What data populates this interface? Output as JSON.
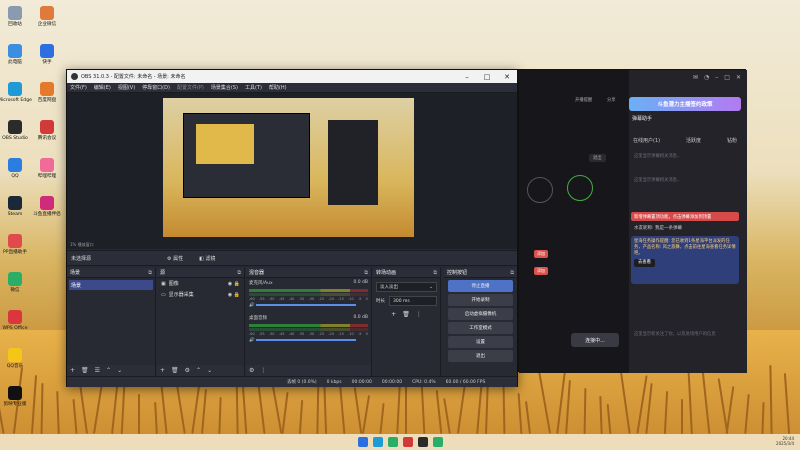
{
  "desktop": {
    "icons": [
      {
        "label": "回收站",
        "color": "#8a9bb0"
      },
      {
        "label": "此电脑",
        "color": "#3c8ee0"
      },
      {
        "label": "Microsoft Edge",
        "color": "#1f9ad6"
      },
      {
        "label": "OBS Studio",
        "color": "#2b2b2b"
      },
      {
        "label": "QQ",
        "color": "#2b7ee0"
      },
      {
        "label": "Steam",
        "color": "#1b2838"
      },
      {
        "label": "PP直播助手",
        "color": "#e04a4a"
      },
      {
        "label": "微信",
        "color": "#2aae67"
      },
      {
        "label": "WPS Office",
        "color": "#d9363e"
      },
      {
        "label": "QQ音乐",
        "color": "#f5c518"
      },
      {
        "label": "剪映专业版",
        "color": "#111111"
      }
    ],
    "icons_right": [
      {
        "label": "企业微信",
        "color": "#e07a3a"
      },
      {
        "label": "快手",
        "color": "#2d6fe0"
      },
      {
        "label": "百度网盘",
        "color": "#e57a2c"
      },
      {
        "label": "腾讯会议",
        "color": "#d23a3a"
      },
      {
        "label": "哔哩哔哩",
        "color": "#f16b9a"
      },
      {
        "label": "斗鱼直播伴侣",
        "color": "#d02a7a"
      }
    ]
  },
  "obs": {
    "title": "OBS 31.0.3 - 配置文件: 未命名 - 场景: 未命名",
    "menu": [
      "文件(F)",
      "编辑(E)",
      "视图(V)",
      "停靠窗口(D)",
      "配置文件(P)",
      "场景集合(S)",
      "工具(T)",
      "帮助(H)"
    ],
    "menu_disabled_index": 4,
    "status_top": "1% 播放窗口",
    "source_label": "未选择源",
    "btn_properties": "属性",
    "btn_filters": "滤镜",
    "scenes": {
      "title": "场景",
      "items": [
        "场景"
      ]
    },
    "sources": {
      "title": "源",
      "items": [
        "图像",
        "显示器采集"
      ]
    },
    "mixer": {
      "title": "混音器",
      "channels": [
        {
          "name": "麦克风/Aux",
          "db": "0.0 dB"
        },
        {
          "name": "桌面音频",
          "db": "0.0 dB"
        }
      ],
      "scale": [
        "-60",
        "-55",
        "-50",
        "-45",
        "-40",
        "-35",
        "-30",
        "-25",
        "-20",
        "-15",
        "-10",
        "-5",
        "0"
      ]
    },
    "transitions": {
      "title": "转场动画",
      "selected": "淡入淡出",
      "duration_label": "时长",
      "duration": "300 ms"
    },
    "controls": {
      "title": "控制按钮",
      "buttons": [
        "停止直播",
        "开始录制",
        "启动虚拟摄像机",
        "工作室模式",
        "设置",
        "退出"
      ]
    },
    "statusbar": {
      "frames": "丢帧 0 (0.0%)",
      "bitrate": "0 kbps",
      "live_time": "00:00:00",
      "rec_time": "00:00:00",
      "cpu": "CPU: 0.4%",
      "fps": "60.00 / 60.00 FPS"
    }
  },
  "app": {
    "banner": "斗鱼潜力主播签约政策",
    "tabs": [
      "在线用户(1)",
      "活跃度",
      "钻粉"
    ],
    "panel_title": "弹幕助手",
    "hint1": "这里显示弹幕相关消息，",
    "hint2": "这里显示弹幕相关消息，",
    "notice": "新增弹幕置顶功能，点击弹幕添加到顶置",
    "user_line": "水友昵称: 我是一条弹幕",
    "card_text": "星海任务操作提醒: 您已收到1条星海平台派发的任务，产品名称: 风之旅舞，点击前往星海查看任务详情吧。",
    "card_btn": "去查看",
    "footer_hint": "这里显示新关注了你，以及进场用户的信息",
    "connect_btn": "连接中...",
    "remind": "开播提醒",
    "share": "分享",
    "exit_btn": "退出",
    "add_label": "添加"
  },
  "taskbar": {
    "time": "20:44",
    "date": "2025/3/4"
  }
}
